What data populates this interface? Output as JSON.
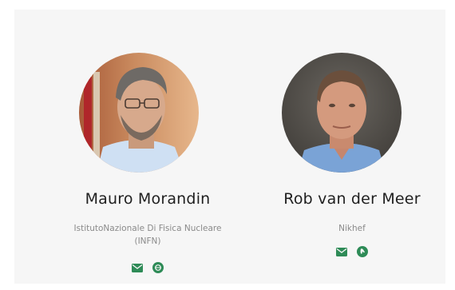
{
  "people": [
    {
      "name": "Mauro Morandin",
      "affiliation": "IstitutoNazionale Di Fisica Nucleare (INFN)",
      "icons": [
        "email-icon",
        "website-icon"
      ]
    },
    {
      "name": "Rob van der Meer",
      "affiliation": "Nikhef",
      "icons": [
        "email-icon",
        "phone-icon"
      ]
    }
  ],
  "colors": {
    "accent": "#2e8b57",
    "panel_bg": "#f6f6f6",
    "name_text": "#1f1f1f",
    "affiliation_text": "#8a8a8a"
  }
}
